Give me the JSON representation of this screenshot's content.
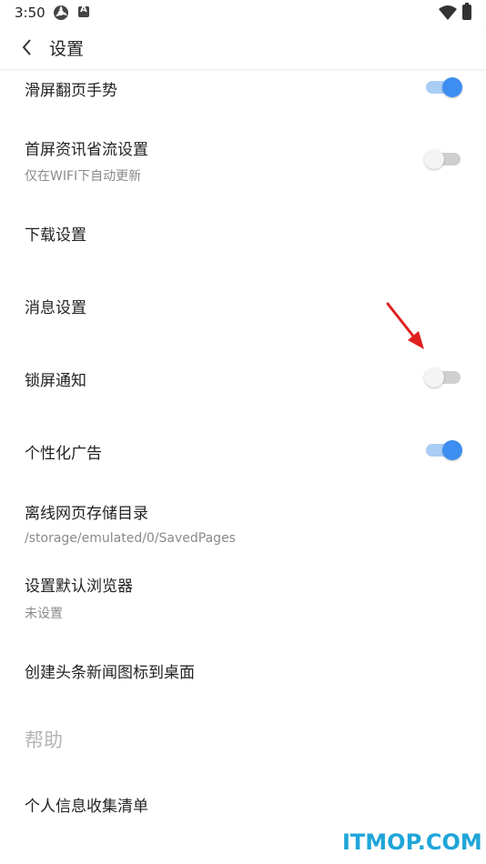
{
  "status": {
    "time": "3:50",
    "icons": [
      "sync-icon",
      "a-badge-icon",
      "wifi-icon",
      "battery-charging-icon"
    ]
  },
  "appbar": {
    "back_icon": "chevron-left-icon",
    "title": "设置"
  },
  "settings": {
    "swipe_gesture": {
      "title": "滑屏翻页手势",
      "enabled": true
    },
    "data_saver": {
      "title": "首屏资讯省流设置",
      "subtitle": "仅在WIFI下自动更新",
      "enabled": false
    },
    "download": {
      "title": "下载设置"
    },
    "message": {
      "title": "消息设置"
    },
    "lockscreen": {
      "title": "锁屏通知",
      "enabled": false
    },
    "personalized_ads": {
      "title": "个性化广告",
      "enabled": true
    },
    "offline_dir": {
      "title": "离线网页存储目录",
      "subtitle": "/storage/emulated/0/SavedPages"
    },
    "default_browser": {
      "title": "设置默认浏览器",
      "subtitle": "未设置"
    },
    "desktop_icon": {
      "title": "创建头条新闻图标到桌面"
    }
  },
  "help_section": {
    "title": "帮助",
    "personal_info": {
      "title": "个人信息收集清单"
    }
  },
  "colors": {
    "accent": "#3d8ef0",
    "accent_track": "#a9cdf5",
    "off_track": "#cfcfcf",
    "arrow": "#e02020",
    "watermark": "#1fa5d8"
  },
  "watermark": "ITMOP.COM"
}
